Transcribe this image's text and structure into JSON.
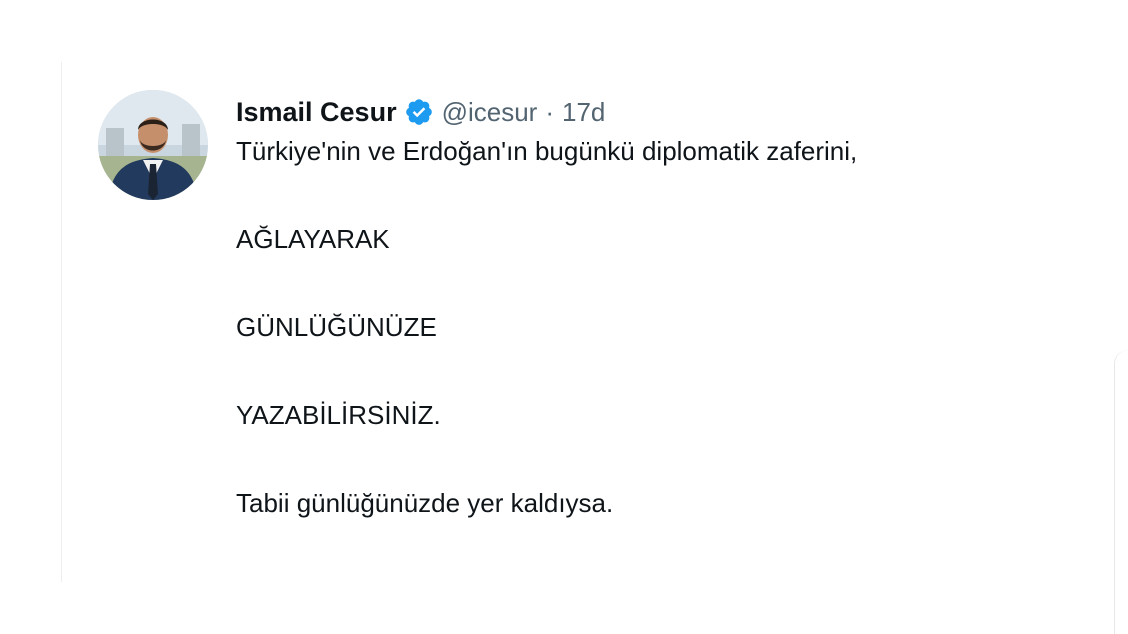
{
  "tweet": {
    "author": {
      "display_name": "Ismail Cesur",
      "handle": "@icesur",
      "verified": true,
      "avatar_icon": "avatar-icon"
    },
    "separator": "·",
    "time": "17d",
    "lines": [
      "Türkiye'nin ve Erdoğan'ın bugünkü diplomatik zaferini,",
      "AĞLAYARAK",
      "GÜNLÜĞÜNÜZE",
      "YAZABİLİRSİNİZ.",
      "Tabii günlüğünüzde yer kaldıysa."
    ]
  },
  "colors": {
    "text": "#0f1419",
    "secondary": "#536471",
    "verified": "#1d9bf0",
    "border": "#eceff1"
  }
}
